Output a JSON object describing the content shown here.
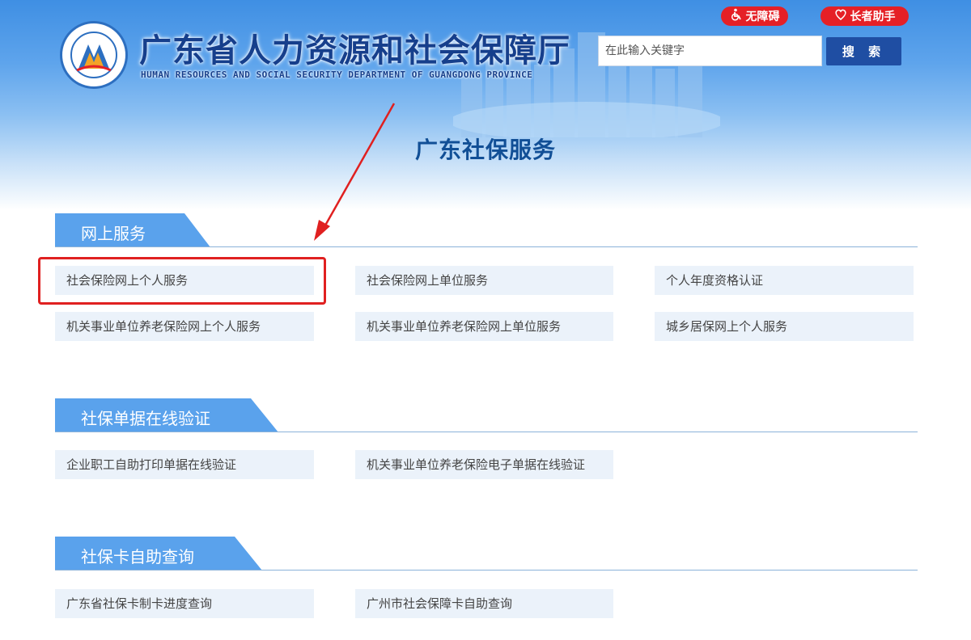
{
  "header": {
    "title": "广东省人力资源和社会保障厅",
    "subtitle": "HUMAN RESOURCES AND SOCIAL SECURITY DEPARTMENT OF GUANGDONG PROVINCE",
    "accessibility_label": "无障碍",
    "elder_label": "长者助手",
    "search_placeholder": "在此输入关键字",
    "search_button": "搜 索"
  },
  "page_heading": "广东社保服务",
  "sections": [
    {
      "title": "网上服务",
      "links": [
        "社会保险网上个人服务",
        "社会保险网上单位服务",
        "个人年度资格认证",
        "机关事业单位养老保险网上个人服务",
        "机关事业单位养老保险网上单位服务",
        "城乡居保网上个人服务"
      ]
    },
    {
      "title": "社保单据在线验证",
      "links": [
        "企业职工自助打印单据在线验证",
        "机关事业单位养老保险电子单据在线验证"
      ]
    },
    {
      "title": "社保卡自助查询",
      "links": [
        "广东省社保卡制卡进度查询",
        "广州市社会保障卡自助查询"
      ]
    }
  ],
  "colors": {
    "brand_blue": "#114f96",
    "section_tab": "#5aa2ec",
    "pill_red": "#e52026",
    "search_button": "#1f4ea3",
    "link_bg": "#ebf2fa",
    "annotation_red": "#e02020"
  },
  "icons": {
    "accessibility": "wheelchair-icon",
    "elder": "heart-hand-icon"
  }
}
